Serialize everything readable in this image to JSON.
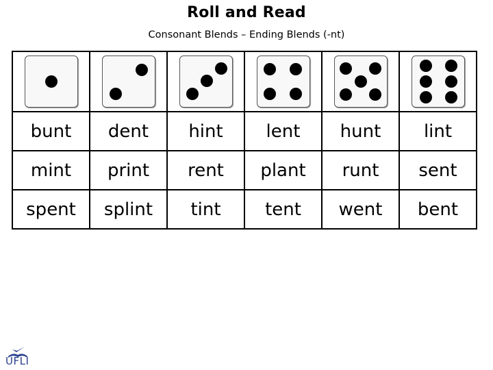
{
  "title": "Roll and Read",
  "subtitle": "Consonant Blends – Ending Blends (-nt)",
  "dice": [
    1,
    2,
    3,
    4,
    5,
    6
  ],
  "rows": [
    [
      "bunt",
      "dent",
      "hint",
      "lent",
      "hunt",
      "lint"
    ],
    [
      "mint",
      "print",
      "rent",
      "plant",
      "runt",
      "sent"
    ],
    [
      "spent",
      "splint",
      "tint",
      "tent",
      "went",
      "bent"
    ]
  ],
  "logo": {
    "text": "UFLI",
    "icon": "bird-over-book-icon",
    "color": "#2a3f8f"
  }
}
